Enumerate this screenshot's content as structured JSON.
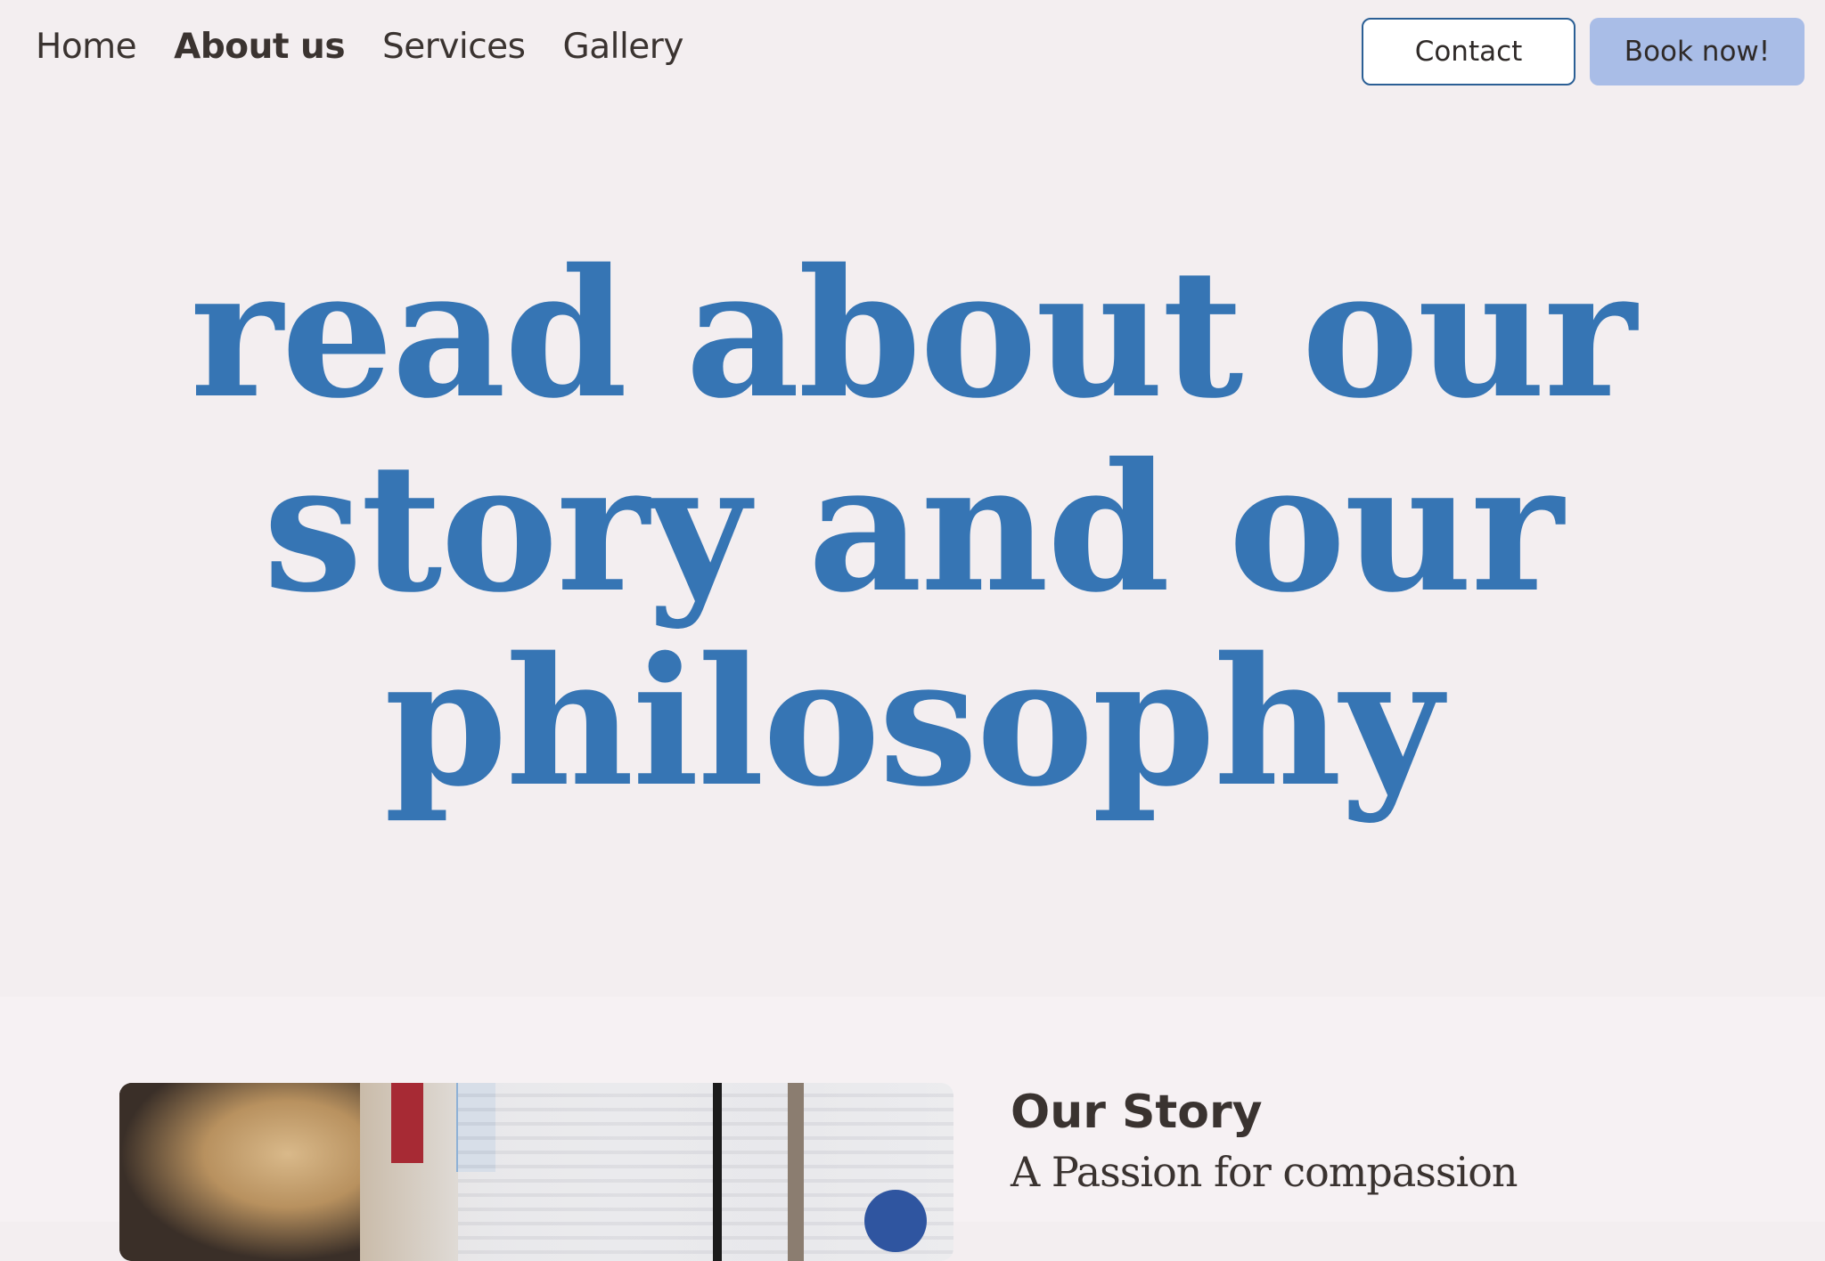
{
  "nav": {
    "links": [
      {
        "label": "Home",
        "active": false
      },
      {
        "label": "About us",
        "active": true
      },
      {
        "label": "Services",
        "active": false
      },
      {
        "label": "Gallery",
        "active": false
      }
    ],
    "contact_label": "Contact",
    "book_label": "Book now!"
  },
  "hero": {
    "title_line1": "read about our",
    "title_line2": "story and our",
    "title_line3": "philosophy"
  },
  "story": {
    "heading": "Our Story",
    "subheading": "A Passion for compassion"
  },
  "colors": {
    "background": "#f3eef0",
    "accent_blue": "#3675b4",
    "book_button": "#a9bde7",
    "contact_border": "#2b5f95",
    "text": "#3a3330"
  }
}
